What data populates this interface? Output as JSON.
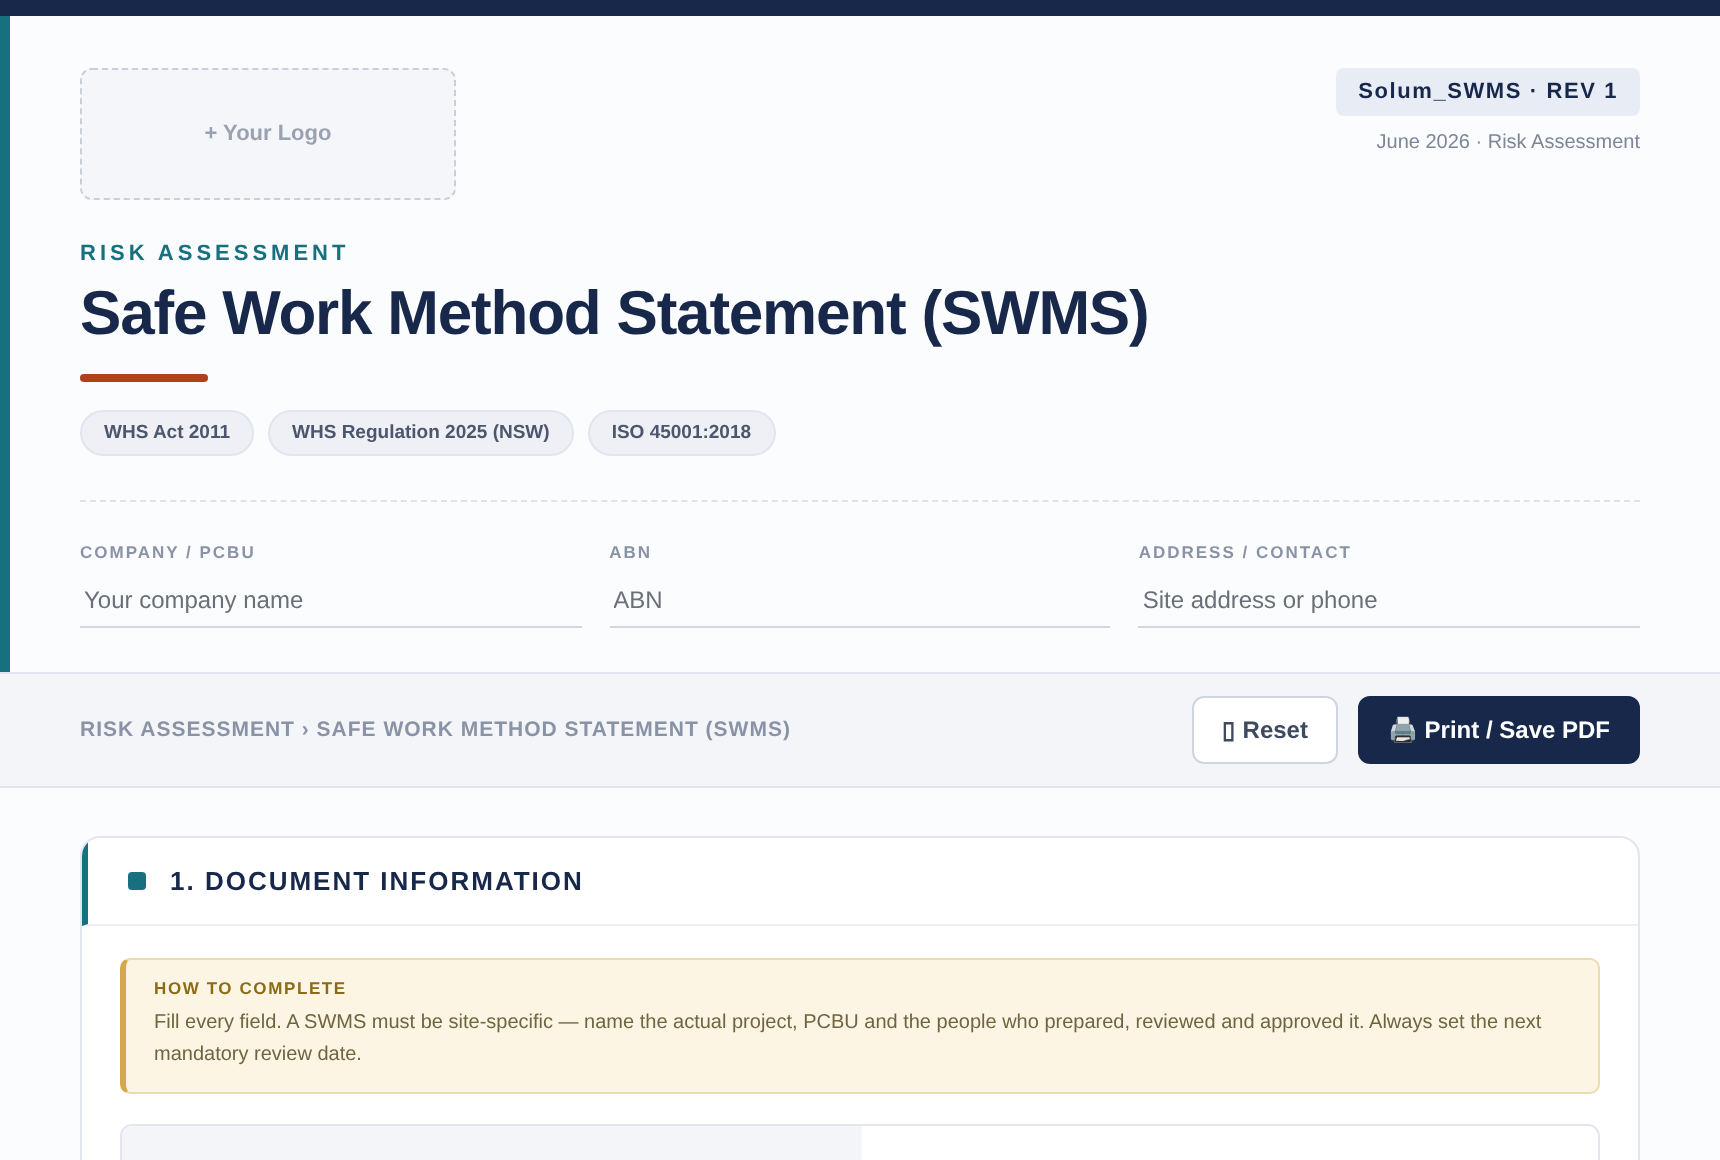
{
  "logo": {
    "label": "+ Your Logo"
  },
  "doc_badge": "Solum_SWMS · REV 1",
  "doc_meta": "June 2026 · Risk Assessment",
  "eyebrow": "RISK ASSESSMENT",
  "title": "Safe Work Method Statement (SWMS)",
  "tags": [
    "WHS Act 2011",
    "WHS Regulation 2025 (NSW)",
    "ISO 45001:2018"
  ],
  "fields": [
    {
      "label": "COMPANY / PCBU",
      "placeholder": "Your company name"
    },
    {
      "label": "ABN",
      "placeholder": "ABN"
    },
    {
      "label": "ADDRESS / CONTACT",
      "placeholder": "Site address or phone"
    }
  ],
  "breadcrumb": "RISK ASSESSMENT › SAFE WORK METHOD STATEMENT (SWMS)",
  "buttons": [
    {
      "kind": "secondary",
      "icon": "▯",
      "label": "Reset"
    },
    {
      "kind": "primary",
      "icon": "🖨️",
      "label": "Print / Save PDF"
    }
  ],
  "section": {
    "title": "1. DOCUMENT INFORMATION",
    "note": {
      "title": "HOW TO COMPLETE",
      "text": "Fill every field. A SWMS must be site-specific — name the actual project, PCBU and the people who prepared, reviewed and approved it. Always set the next mandatory review date."
    }
  }
}
